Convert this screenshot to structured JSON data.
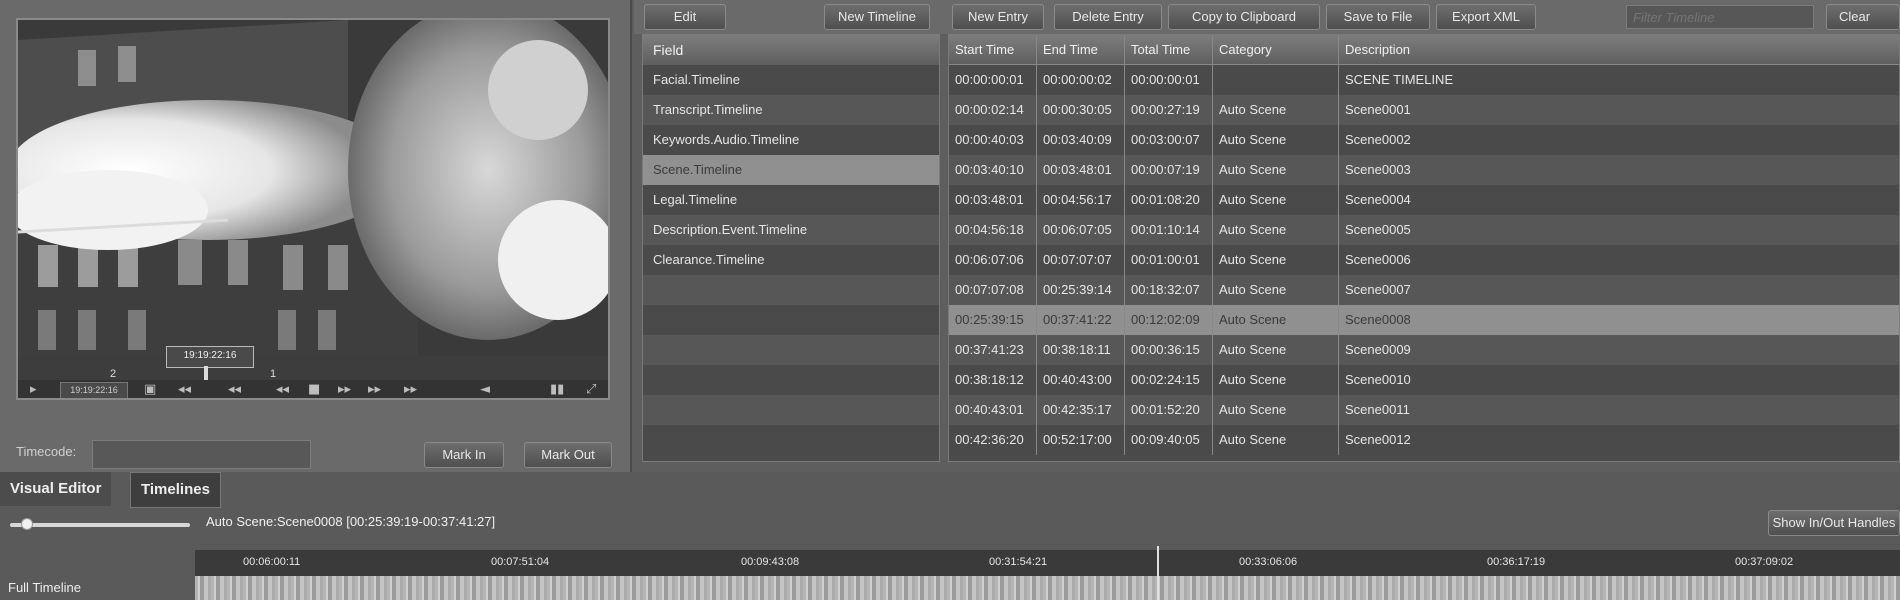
{
  "toolbar": {
    "edit": "Edit",
    "new_timeline": "New Timeline",
    "new_entry": "New Entry",
    "delete_entry": "Delete Entry",
    "copy_clipboard": "Copy to Clipboard",
    "save_file": "Save to File",
    "export_xml": "Export XML",
    "filter_placeholder": "Filter Timeline",
    "clear": "Clear"
  },
  "player": {
    "tooltip_time": "19:19:22:16",
    "transport_timecode": "19:19:22:16",
    "mark_left": "2",
    "mark_right": "1",
    "timecode_label": "Timecode:",
    "mark_in": "Mark In",
    "mark_out": "Mark Out"
  },
  "fields": {
    "header": "Field",
    "items": [
      "Facial.Timeline",
      "Transcript.Timeline",
      "Keywords.Audio.Timeline",
      "Scene.Timeline",
      "Legal.Timeline",
      "Description.Event.Timeline",
      "Clearance.Timeline"
    ],
    "selected_index": 3
  },
  "table": {
    "headers": [
      "Start Time",
      "End Time",
      "Total Time",
      "Category",
      "Description"
    ],
    "rows": [
      [
        "00:00:00:01",
        "00:00:00:02",
        "00:00:00:01",
        "",
        "SCENE TIMELINE"
      ],
      [
        "00:00:02:14",
        "00:00:30:05",
        "00:00:27:19",
        "Auto Scene",
        "Scene0001"
      ],
      [
        "00:00:40:03",
        "00:03:40:09",
        "00:03:00:07",
        "Auto Scene",
        "Scene0002"
      ],
      [
        "00:03:40:10",
        "00:03:48:01",
        "00:00:07:19",
        "Auto Scene",
        "Scene0003"
      ],
      [
        "00:03:48:01",
        "00:04:56:17",
        "00:01:08:20",
        "Auto Scene",
        "Scene0004"
      ],
      [
        "00:04:56:18",
        "00:06:07:05",
        "00:01:10:14",
        "Auto Scene",
        "Scene0005"
      ],
      [
        "00:06:07:06",
        "00:07:07:07",
        "00:01:00:01",
        "Auto Scene",
        "Scene0006"
      ],
      [
        "00:07:07:08",
        "00:25:39:14",
        "00:18:32:07",
        "Auto Scene",
        "Scene0007"
      ],
      [
        "00:25:39:15",
        "00:37:41:22",
        "00:12:02:09",
        "Auto Scene",
        "Scene0008"
      ],
      [
        "00:37:41:23",
        "00:38:18:11",
        "00:00:36:15",
        "Auto Scene",
        "Scene0009"
      ],
      [
        "00:38:18:12",
        "00:40:43:00",
        "00:02:24:15",
        "Auto Scene",
        "Scene0010"
      ],
      [
        "00:40:43:01",
        "00:42:35:17",
        "00:01:52:20",
        "Auto Scene",
        "Scene0011"
      ],
      [
        "00:42:36:20",
        "00:52:17:00",
        "00:09:40:05",
        "Auto Scene",
        "Scene0012"
      ]
    ],
    "selected_index": 8
  },
  "bottom": {
    "tab_visual_editor": "Visual Editor",
    "tab_timelines": "Timelines",
    "scene_info": "Auto Scene:Scene0008 [00:25:39:19-00:37:41:27]",
    "show_inout": "Show In/Out Handles",
    "full_timeline_label": "Full Timeline",
    "slider_value": 0.05,
    "ruler_labels": [
      "00:06:00:11",
      "00:07:51:04",
      "00:09:43:08",
      "00:31:54:21",
      "00:33:06:06",
      "00:36:17:19",
      "00:37:09:02"
    ]
  }
}
